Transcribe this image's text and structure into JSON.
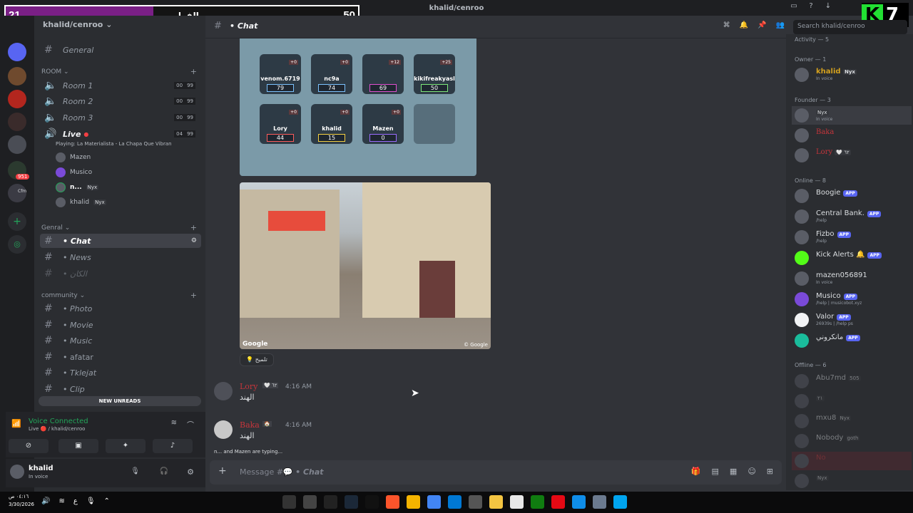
{
  "window": {
    "title": "khalid/cenroo"
  },
  "score_overlay": {
    "left_score": "21",
    "center_text": "الفولو",
    "right_score": "50",
    "fill_fraction": 0.42
  },
  "logo_overlay": {
    "letter": "K",
    "number": "7"
  },
  "guild_badges": {
    "mentions": "951",
    "dm_label": "Cfm"
  },
  "server": {
    "name": "khalid/cenroo"
  },
  "channels": {
    "general": "General",
    "room_category": "ROOM",
    "rooms": [
      {
        "name": "Room 1",
        "left": "00",
        "right": "99"
      },
      {
        "name": "Room 2",
        "left": "00",
        "right": "99"
      },
      {
        "name": "Room 3",
        "left": "00",
        "right": "99"
      }
    ],
    "live": {
      "name": "Live",
      "left": "04",
      "right": "99",
      "activity": "Playing: La Materialista - La Chapa Que Vibran"
    },
    "voice_users": [
      {
        "name": "Mazen",
        "tag": ""
      },
      {
        "name": "Musico",
        "tag": ""
      },
      {
        "name": "n...",
        "tag": "Nyx"
      },
      {
        "name": "khalid",
        "tag": "Nyx"
      }
    ],
    "genral_category": "Genral",
    "genral_channels": [
      "• Chat",
      "• News",
      "• الكان"
    ],
    "community_category": "community",
    "community_channels": [
      "• Photo",
      "• Movie",
      "• Music",
      "• afatar",
      "• Tklejat",
      "• Clip"
    ],
    "new_unreads": "NEW UNREADS"
  },
  "voice_panel": {
    "title": "Voice Connected",
    "subtitle": "Live 🔴 / khalid/cenroo"
  },
  "user_panel": {
    "name": "khalid",
    "status": "In voice"
  },
  "chat_header": {
    "channel": "• Chat",
    "search_placeholder": "Search khalid/cenroo"
  },
  "game_card": {
    "tiles": [
      {
        "name": "venom.6719",
        "score": "79",
        "plus": "+0"
      },
      {
        "name": "nc9a",
        "score": "74",
        "plus": "+0"
      },
      {
        "name": "",
        "score": "69",
        "plus": "+12"
      },
      {
        "name": "kikifreakyasl",
        "score": "50",
        "plus": "+25"
      },
      {
        "name": "Lory",
        "score": "44",
        "plus": "+0"
      },
      {
        "name": "khalid",
        "score": "15",
        "plus": "+0"
      },
      {
        "name": "Mazen",
        "score": "0",
        "plus": "+0"
      }
    ]
  },
  "street_image": {
    "left_mark": "Google",
    "right_mark": "© Google"
  },
  "reaction": {
    "label": "💡 تلميح"
  },
  "messages": [
    {
      "author": "Lory",
      "tag": "🤍 ٦٢",
      "time": "4:16 AM",
      "body": "الهند"
    },
    {
      "author": "Baka",
      "tag": "🏠",
      "time": "4:16 AM",
      "body": "الهند"
    }
  ],
  "typing": {
    "users": "n... and Mazen are typing..."
  },
  "composer": {
    "placeholder": "Message #💬",
    "channel": "• Chat"
  },
  "members": {
    "activity_header": "Activity — 5",
    "owner_header": "Owner — 1",
    "owner": [
      {
        "name": "khalid",
        "tag": "Nyx",
        "status": "In voice"
      }
    ],
    "founder_header": "Founder — 3",
    "founders": [
      {
        "name": "",
        "tag": "Nyx",
        "status": "In voice"
      },
      {
        "name": "Baka",
        "tag": "",
        "status": ""
      },
      {
        "name": "Lory",
        "tag": "🤍 ٦٢",
        "status": ""
      }
    ],
    "online_header": "Online — 8",
    "online": [
      {
        "name": "Boogie",
        "app": "APP",
        "status": ""
      },
      {
        "name": "Central Bank.",
        "app": "APP",
        "status": "/help"
      },
      {
        "name": "Fizbo",
        "app": "APP",
        "status": "/help"
      },
      {
        "name": "Kick Alerts 🔔",
        "app": "APP",
        "status": ""
      },
      {
        "name": "mazen056891",
        "app": "",
        "status": "In voice"
      },
      {
        "name": "Musico",
        "app": "APP",
        "status": "/help | musicobot.xyz"
      },
      {
        "name": "Valor",
        "app": "APP",
        "status": "26939s | /help ps"
      },
      {
        "name": "مانكروني",
        "app": "APP",
        "status": ""
      }
    ],
    "offline_header": "Offline — 6",
    "offline": [
      {
        "name": "Abu7md",
        "tag": "505"
      },
      {
        "name": "",
        "tag": "٢١"
      },
      {
        "name": "mxu8",
        "tag": "Nyx"
      },
      {
        "name": "Nobody",
        "tag": "goth"
      },
      {
        "name": "No",
        "tag": ""
      },
      {
        "name": "",
        "tag": "Nyx"
      }
    ]
  },
  "taskbar": {
    "time": "٠٤:١٦ ص",
    "date": "3/30/2026",
    "lang": "ع"
  },
  "colors": {
    "accent": "#5865f2",
    "green": "#23a55a",
    "red_name": "#c4353b",
    "score_fill": "#7a1f86"
  }
}
